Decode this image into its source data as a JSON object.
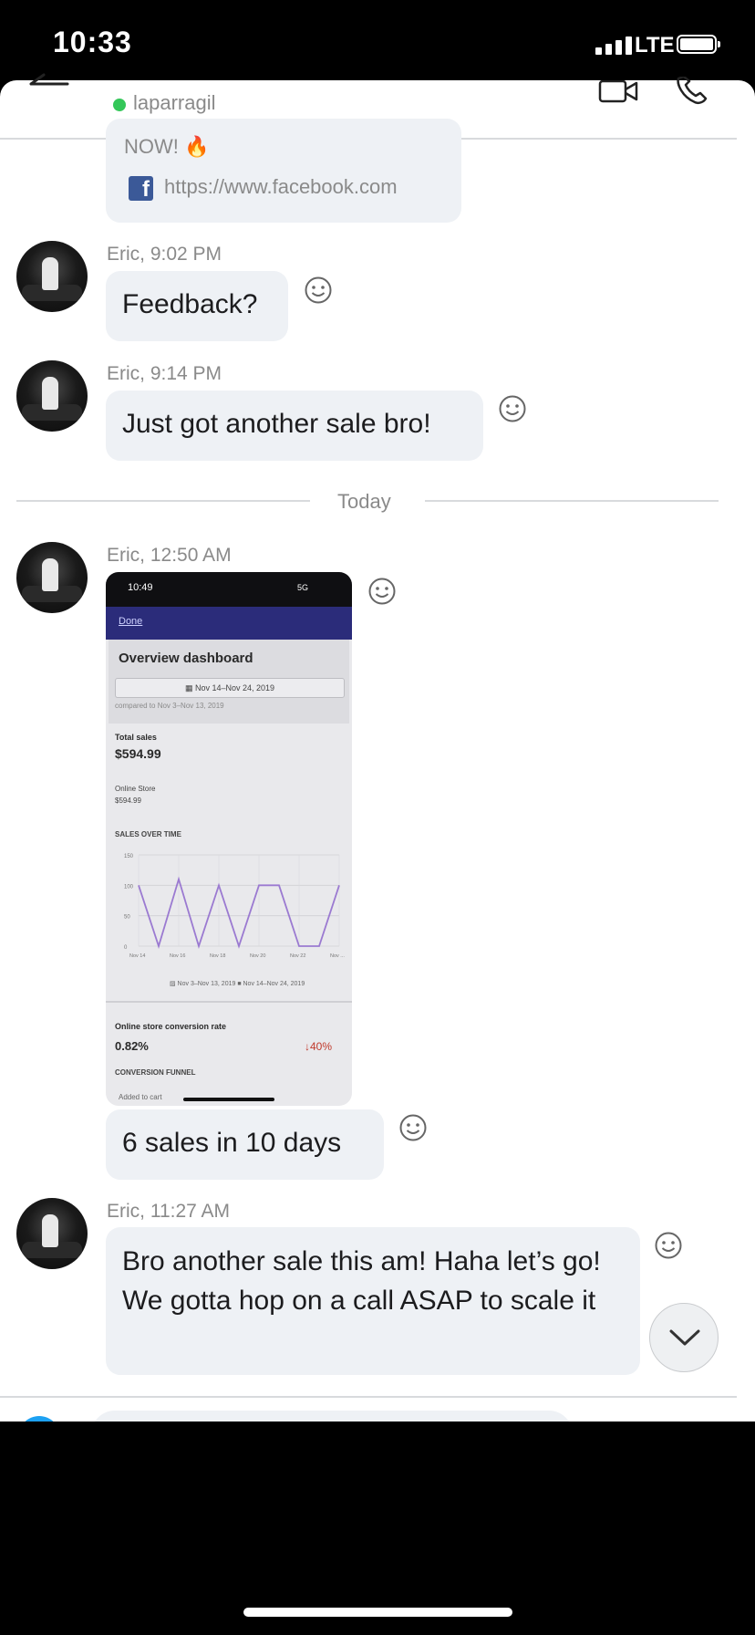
{
  "status_bar": {
    "time": "10:33",
    "network": "LTE"
  },
  "header": {
    "contact_name": "laparragil"
  },
  "previous_message": {
    "text": "NOW! 🔥",
    "link": "https://www.facebook.com"
  },
  "messages": [
    {
      "sender_time": "Eric, 9:02 PM",
      "text": "Feedback?"
    },
    {
      "sender_time": "Eric, 9:14 PM",
      "text": "Just got another sale bro!"
    },
    {
      "sender_time": "Eric, 12:50 AM",
      "text": "6 sales in 10 days"
    },
    {
      "sender_time": "Eric, 11:27 AM",
      "text": "Bro another sale this am! Haha let’s go! We gotta hop on a call ASAP to scale it"
    }
  ],
  "date_divider": "Today",
  "shared_screenshot": {
    "time": "10:49",
    "network": "5G",
    "done_label": "Done",
    "title": "Overview dashboard",
    "date_range": "▦ Nov 14–Nov 24, 2019",
    "compared": "compared to Nov 3–Nov 13, 2019",
    "total_sales_label": "Total sales",
    "total_sales_value": "$594.99",
    "online_store_label": "Online Store",
    "online_store_value": "$594.99",
    "sales_over_time_label": "SALES OVER TIME",
    "legend": "▨ Nov 3–Nov 13, 2019   ■ Nov 14–Nov 24, 2019",
    "conversion_label": "Online store conversion rate",
    "conversion_value": "0.82%",
    "conversion_change": "↓40%",
    "funnel_label": "CONVERSION FUNNEL",
    "added_to_cart_label": "Added to cart"
  },
  "chart_data": {
    "type": "line",
    "title": "SALES OVER TIME",
    "x": [
      "Nov 14",
      "Nov 15",
      "Nov 16",
      "Nov 17",
      "Nov 18",
      "Nov 19",
      "Nov 20",
      "Nov 21",
      "Nov 22",
      "Nov 23",
      "Nov 24"
    ],
    "series": [
      {
        "name": "Nov 14–Nov 24, 2019",
        "values": [
          100,
          0,
          110,
          0,
          100,
          0,
          100,
          100,
          0,
          0,
          100
        ]
      }
    ],
    "x_tick_labels": [
      "Nov 14",
      "Nov 16",
      "Nov 18",
      "Nov 20",
      "Nov 22",
      "Nov ..."
    ],
    "y_tick_labels": [
      "150",
      "100",
      "50",
      "0"
    ],
    "ylim": [
      0,
      150
    ],
    "line_color": "#9b7ad1",
    "grid": true
  },
  "colors": {
    "online": "#34c759",
    "bubble": "#eef1f5",
    "facebook": "#3b5998"
  }
}
